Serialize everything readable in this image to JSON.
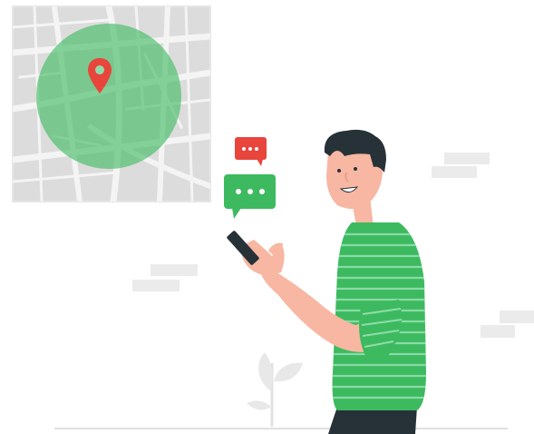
{
  "illustration": {
    "palette": {
      "green": "#3dba5f",
      "green_light": "#8fdcaa",
      "red": "#e8453c",
      "map_bg": "#dcdcdc",
      "map_road": "#f4f4f4",
      "skin": "#f7b7a3",
      "hair": "#263238",
      "pants": "#263238",
      "ground": "#e0e0e0",
      "bricks": "#ebebeb"
    },
    "icons": [
      "map-icon",
      "location-pin-icon",
      "chat-bubble-red-icon",
      "chat-bubble-green-icon",
      "smartphone-icon",
      "plant-icon"
    ],
    "chat_bubbles": {
      "red_dots": 3,
      "green_dots": 3
    }
  }
}
